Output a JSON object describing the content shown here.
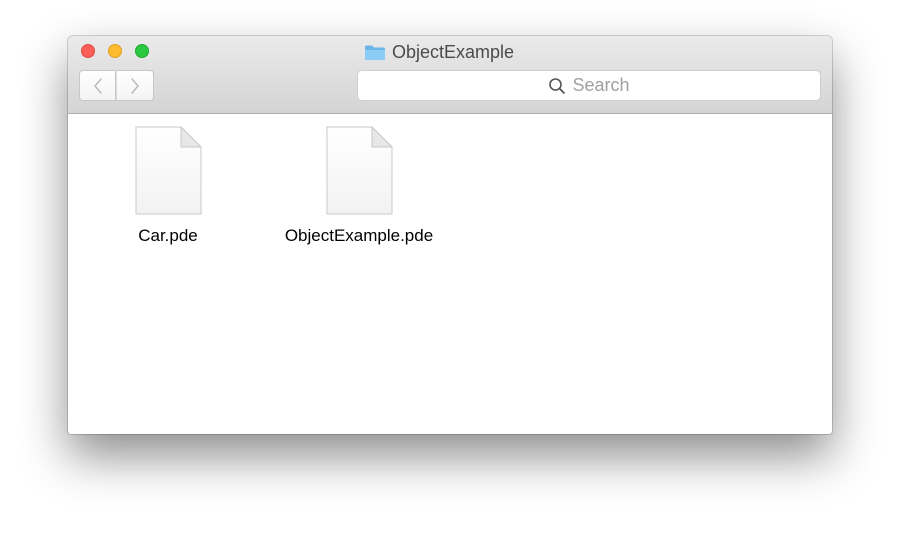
{
  "window": {
    "title": "ObjectExample",
    "title_icon": "folder-icon"
  },
  "toolbar": {
    "back_icon": "chevron-left-icon",
    "forward_icon": "chevron-right-icon",
    "search": {
      "placeholder": "Search",
      "icon": "search-icon"
    }
  },
  "files": [
    {
      "name": "Car.pde",
      "icon": "document-icon"
    },
    {
      "name": "ObjectExample.pde",
      "icon": "document-icon"
    }
  ],
  "colors": {
    "close": "#fc5f57",
    "minimize": "#fdbc2e",
    "zoom": "#29c840",
    "folder": "#7cc3f0"
  }
}
